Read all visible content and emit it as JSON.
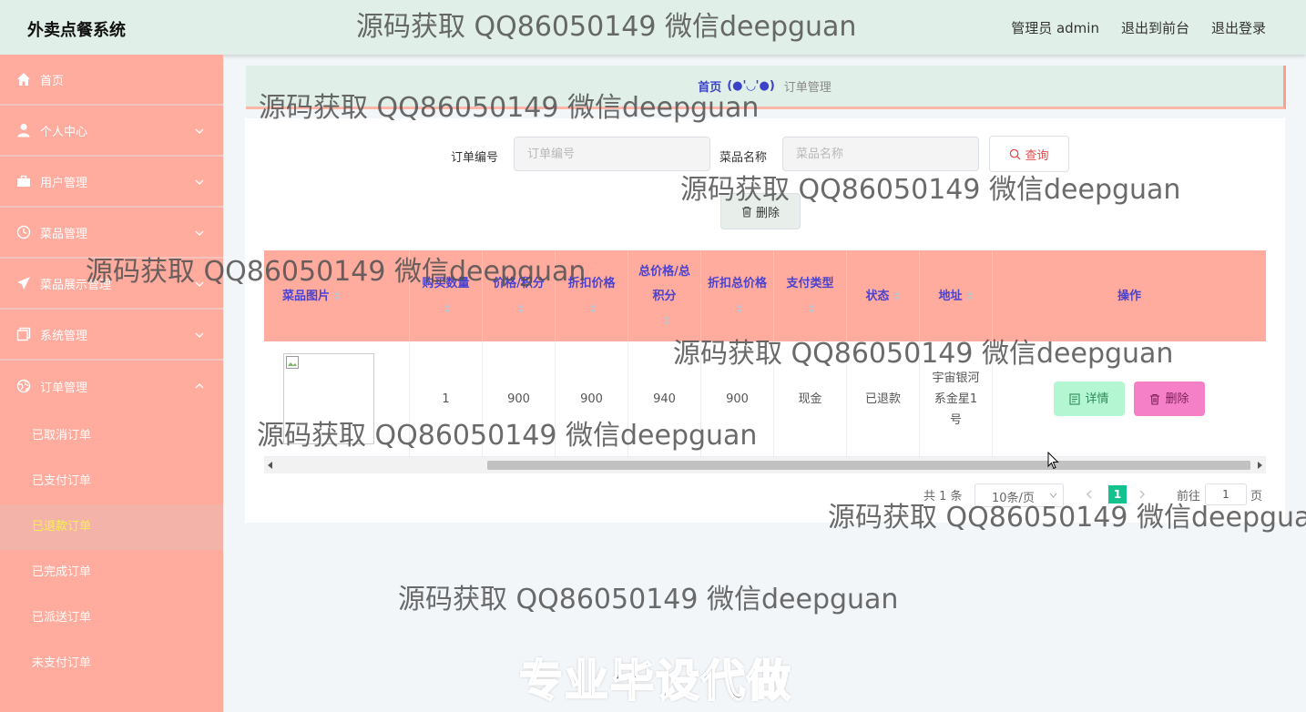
{
  "header": {
    "title": "外卖点餐系统",
    "admin_label": "管理员 admin",
    "to_front_label": "退出到前台",
    "logout_label": "退出登录"
  },
  "sidebar": {
    "items": [
      {
        "label": "首页",
        "icon": "home-icon",
        "has_arrow": false
      },
      {
        "label": "个人中心",
        "icon": "user-icon",
        "has_arrow": true
      },
      {
        "label": "用户管理",
        "icon": "briefcase-icon",
        "has_arrow": true
      },
      {
        "label": "菜品管理",
        "icon": "clock-icon",
        "has_arrow": true
      },
      {
        "label": "菜品展示管理",
        "icon": "paper-plane-icon",
        "has_arrow": true
      },
      {
        "label": "系统管理",
        "icon": "copy-icon",
        "has_arrow": true
      },
      {
        "label": "订单管理",
        "icon": "globe-icon",
        "has_arrow": true,
        "expanded": true
      }
    ],
    "submenu": [
      {
        "label": "已取消订单",
        "active": false
      },
      {
        "label": "已支付订单",
        "active": false
      },
      {
        "label": "已退款订单",
        "active": true
      },
      {
        "label": "已完成订单",
        "active": false
      },
      {
        "label": "已派送订单",
        "active": false
      },
      {
        "label": "未支付订单",
        "active": false
      }
    ]
  },
  "breadcrumb": {
    "home": "首页",
    "separator": "(●'◡'●)",
    "current": "订单管理"
  },
  "search": {
    "order_no_label": "订单编号",
    "order_no_placeholder": "订单编号",
    "dish_name_label": "菜品名称",
    "dish_name_placeholder": "菜品名称",
    "query_label": "查询",
    "delete_label": "删除"
  },
  "table": {
    "columns": [
      {
        "label": "菜品图片",
        "sortable": true
      },
      {
        "label": "购买数量",
        "sortable": true
      },
      {
        "label": "价格/积分",
        "sortable": true
      },
      {
        "label": "折扣价格",
        "sortable": true
      },
      {
        "label": "总价格/总积分",
        "sortable": true
      },
      {
        "label": "折扣总价格",
        "sortable": true
      },
      {
        "label": "支付类型",
        "sortable": true
      },
      {
        "label": "状态",
        "sortable": true
      },
      {
        "label": "地址",
        "sortable": true
      },
      {
        "label": "操作",
        "sortable": false
      }
    ],
    "rows": [
      {
        "quantity": "1",
        "price": "900",
        "discount_price": "900",
        "total_price": "940",
        "discount_total": "900",
        "pay_type": "现金",
        "status": "已退款",
        "address": "宇宙银河系金星1号",
        "detail_label": "详情",
        "delete_label": "删除"
      }
    ]
  },
  "pagination": {
    "total_text": "共 1 条",
    "page_size": "10条/页",
    "current_page": "1",
    "goto_label": "前往",
    "goto_value": "1",
    "page_suffix": "页"
  },
  "watermarks": {
    "text": "源码获取 QQ86050149 微信deepguan",
    "banner": "专业毕设代做"
  },
  "colors": {
    "header_bg": "#e0efe7",
    "sidebar_bg": "#ffab9e",
    "active_submenu_text": "#f8f050",
    "column_header_text": "#4a43d0",
    "detail_button_bg": "#b4f6d2",
    "delete_button_bg": "#f580c8",
    "pager_active": "#13c28e"
  }
}
